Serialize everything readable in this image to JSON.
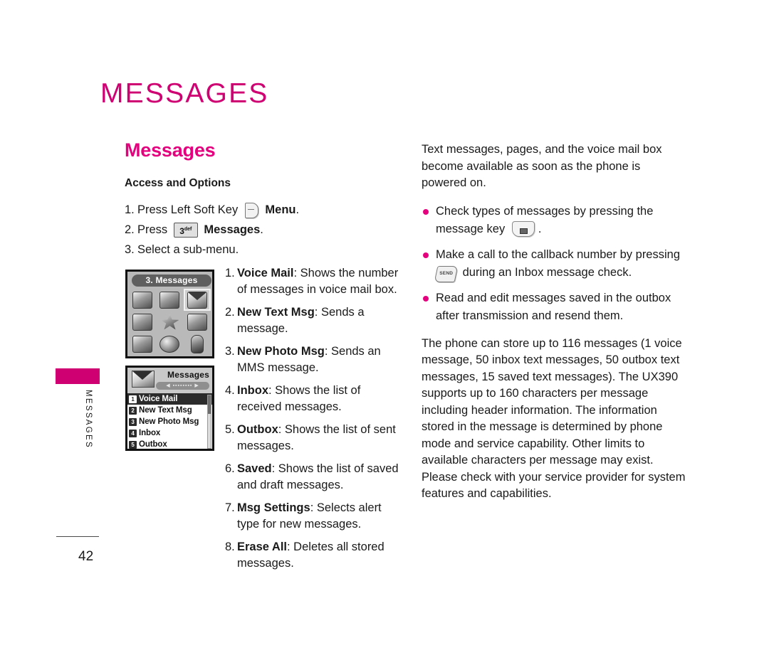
{
  "chapter": {
    "title": "MESSAGES"
  },
  "margin": {
    "tab_color": "#CE0072",
    "vertical_label": "MESSAGES"
  },
  "footer": {
    "page_number": "42"
  },
  "left_column": {
    "section_title": "Messages",
    "sub_title": "Access and Options",
    "steps": [
      {
        "num": "1.",
        "before": "Press Left Soft Key",
        "key": "left-soft-key",
        "after_bold": "Menu",
        "after": "."
      },
      {
        "num": "2.",
        "before": "Press",
        "key": "key-3-def",
        "key_label": "3",
        "key_sup": "def",
        "after_bold": "Messages",
        "after": "."
      },
      {
        "num": "3.",
        "before": "Select a sub-menu.",
        "key": "",
        "after_bold": "",
        "after": ""
      }
    ]
  },
  "phone_menu_screen": {
    "header": "3. Messages",
    "selected_cell_index": 2,
    "cells": [
      "notebook-icon",
      "map-phone-icon",
      "envelope-icon",
      "phone-icon",
      "star-icon",
      "note-icon",
      "briefcase-icon",
      "gears-icon",
      "person-icon"
    ]
  },
  "phone_list_screen": {
    "title": "Messages",
    "pager": "◀ ▪▪▪▪▪▪▪▪ ▶",
    "rows": [
      {
        "idx": "1",
        "label": "Voice Mail",
        "active": true
      },
      {
        "idx": "2",
        "label": "New Text Msg",
        "active": false
      },
      {
        "idx": "3",
        "label": "New Photo Msg",
        "active": false
      },
      {
        "idx": "4",
        "label": "Inbox",
        "active": false
      },
      {
        "idx": "5",
        "label": "Outbox",
        "active": false
      }
    ]
  },
  "definitions": [
    {
      "num": "1.",
      "term": "Voice Mail",
      "desc": ": Shows the number of messages in voice mail box."
    },
    {
      "num": "2.",
      "term": "New Text Msg",
      "desc": ": Sends a message."
    },
    {
      "num": "3.",
      "term": "New Photo Msg",
      "desc": ": Sends an MMS message."
    },
    {
      "num": "4.",
      "term": "Inbox",
      "desc": ": Shows the list of received messages."
    },
    {
      "num": "5.",
      "term": "Outbox",
      "desc": ": Shows the list of sent messages."
    },
    {
      "num": "6.",
      "term": "Saved",
      "desc": ": Shows the list of saved and draft messages."
    },
    {
      "num": "7.",
      "term": "Msg Settings",
      "desc": ": Selects alert type for new messages."
    },
    {
      "num": "8.",
      "term": "Erase All",
      "desc": ": Deletes all stored messages."
    }
  ],
  "right_column": {
    "intro": "Text messages, pages, and the voice mail box become available as soon as the phone is powered on.",
    "bullets": [
      {
        "before": "Check types of messages by pressing the message key",
        "key": "message-key",
        "after": "."
      },
      {
        "before": "Make a call to the callback number by pressing",
        "key": "send-key",
        "key_label": "SEND",
        "after": "during an Inbox message check."
      },
      {
        "before": "Read and edit messages saved in the outbox after transmission and resend them.",
        "key": "",
        "after": ""
      }
    ],
    "closing": "The phone can store up to 116 messages (1 voice message, 50 inbox text messages, 50 outbox text messages, 15 saved text messages). The UX390 supports up to 160 characters per message including header information. The information stored in the message is determined by phone mode and service capability. Other limits to available characters per message may exist. Please check with your service provider for system features and capabilities."
  },
  "colors": {
    "magenta": "#E5007E",
    "tab_magenta": "#CE0072",
    "text": "#1a1a1a"
  }
}
